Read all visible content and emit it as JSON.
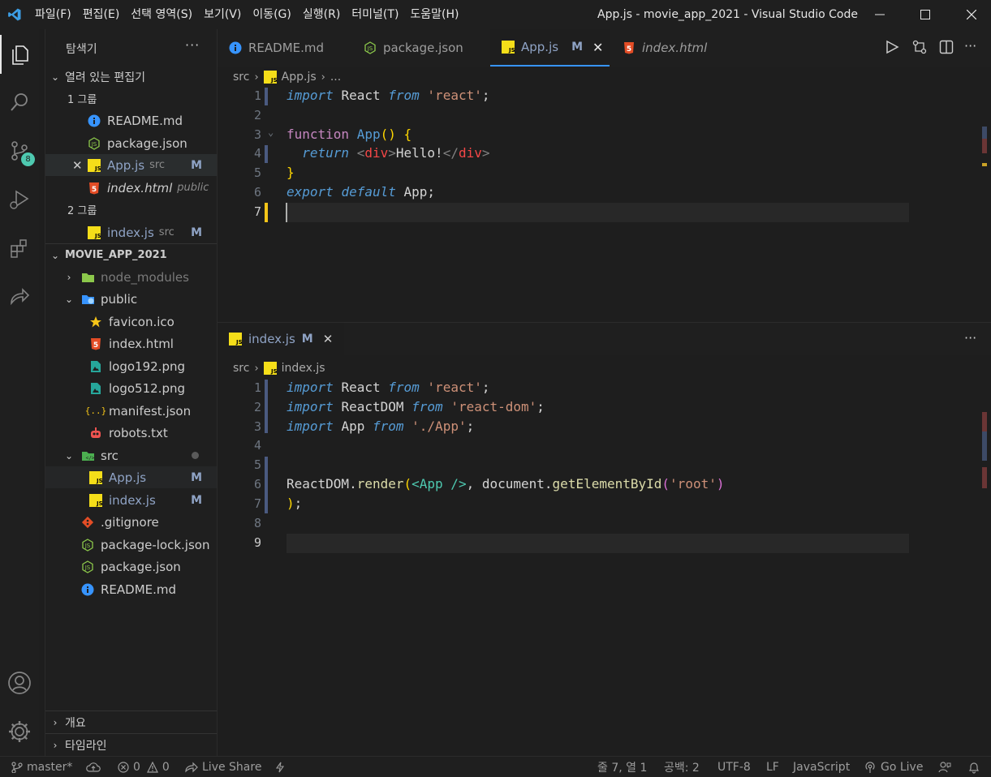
{
  "titlebar": {
    "menu": [
      "파일(F)",
      "편집(E)",
      "선택 영역(S)",
      "보기(V)",
      "이동(G)",
      "실행(R)",
      "터미널(T)",
      "도움말(H)"
    ],
    "window_title": "App.js - movie_app_2021 - Visual Studio Code"
  },
  "activity": {
    "scm_badge": "8"
  },
  "sidebar": {
    "title": "탐색기",
    "more": "···",
    "open_editors": {
      "label": "열려 있는 편집기",
      "group1": "1 그룹",
      "group2": "2 그룹",
      "g1": [
        {
          "name": "README.md",
          "desc": "",
          "flag": ""
        },
        {
          "name": "package.json",
          "desc": "",
          "flag": ""
        },
        {
          "name": "App.js",
          "desc": "src",
          "flag": "M"
        },
        {
          "name": "index.html",
          "desc": "public",
          "flag": ""
        }
      ],
      "g2": [
        {
          "name": "index.js",
          "desc": "src",
          "flag": "M"
        }
      ]
    },
    "project": {
      "label": "MOVIE_APP_2021",
      "items": [
        {
          "name": "node_modules",
          "flag": ""
        },
        {
          "name": "public",
          "flag": ""
        },
        {
          "name": "favicon.ico",
          "flag": ""
        },
        {
          "name": "index.html",
          "flag": ""
        },
        {
          "name": "logo192.png",
          "flag": ""
        },
        {
          "name": "logo512.png",
          "flag": ""
        },
        {
          "name": "manifest.json",
          "flag": ""
        },
        {
          "name": "robots.txt",
          "flag": ""
        },
        {
          "name": "src",
          "flag": ""
        },
        {
          "name": "App.js",
          "flag": "M"
        },
        {
          "name": "index.js",
          "flag": "M"
        },
        {
          "name": ".gitignore",
          "flag": ""
        },
        {
          "name": "package-lock.json",
          "flag": ""
        },
        {
          "name": "package.json",
          "flag": ""
        },
        {
          "name": "README.md",
          "flag": ""
        }
      ]
    },
    "outline": "개요",
    "timeline": "타임라인"
  },
  "editor_top": {
    "tabs": [
      {
        "label": "README.md",
        "flag": ""
      },
      {
        "label": "package.json",
        "flag": ""
      },
      {
        "label": "App.js",
        "flag": "M"
      },
      {
        "label": "index.html",
        "flag": ""
      }
    ],
    "breadcrumb": [
      "src",
      "App.js",
      "..."
    ],
    "line_numbers": [
      "1",
      "2",
      "3",
      "4",
      "5",
      "6",
      "7"
    ]
  },
  "editor_bottom": {
    "tab": {
      "label": "index.js",
      "flag": "M"
    },
    "breadcrumb": [
      "src",
      "index.js"
    ],
    "line_numbers": [
      "1",
      "2",
      "3",
      "4",
      "5",
      "6",
      "7",
      "8",
      "9"
    ]
  },
  "code": {
    "import": "import",
    "from": "from",
    "react_id": "React",
    "react_str": "'react'",
    "function": "function",
    "app_name": "App",
    "parens": "()",
    "brace_open": "{",
    "brace_close": "}",
    "return": "return",
    "div_open_lt": "<",
    "div": "div",
    "gt": ">",
    "hello": "Hello!",
    "div_close_lt": "</",
    "export": "export",
    "default": "default",
    "semi": ";",
    "reactdom": "ReactDOM",
    "reactdom_str": "'react-dom'",
    "app_str": "'./App'",
    "render": "render",
    "paren_open": "(",
    "paren_close": ")",
    "app_tag": "<App />",
    "comma_doc": ", document.",
    "getel": "getElementById",
    "root_str": "'root'",
    "dot": "."
  },
  "status": {
    "branch": "master*",
    "errors": "0",
    "warnings": "0",
    "liveshare": "Live Share",
    "position": "줄 7, 열 1",
    "spaces": "공백: 2",
    "encoding": "UTF-8",
    "eol": "LF",
    "language": "JavaScript",
    "golive": "Go Live"
  },
  "colors": {
    "accent": "#3794ff",
    "js_icon": "#f5de19",
    "html_icon": "#e44d26",
    "info_icon": "#3794ff",
    "node_icon": "#8cc84b",
    "scm_badge": "#4ec9b0"
  }
}
